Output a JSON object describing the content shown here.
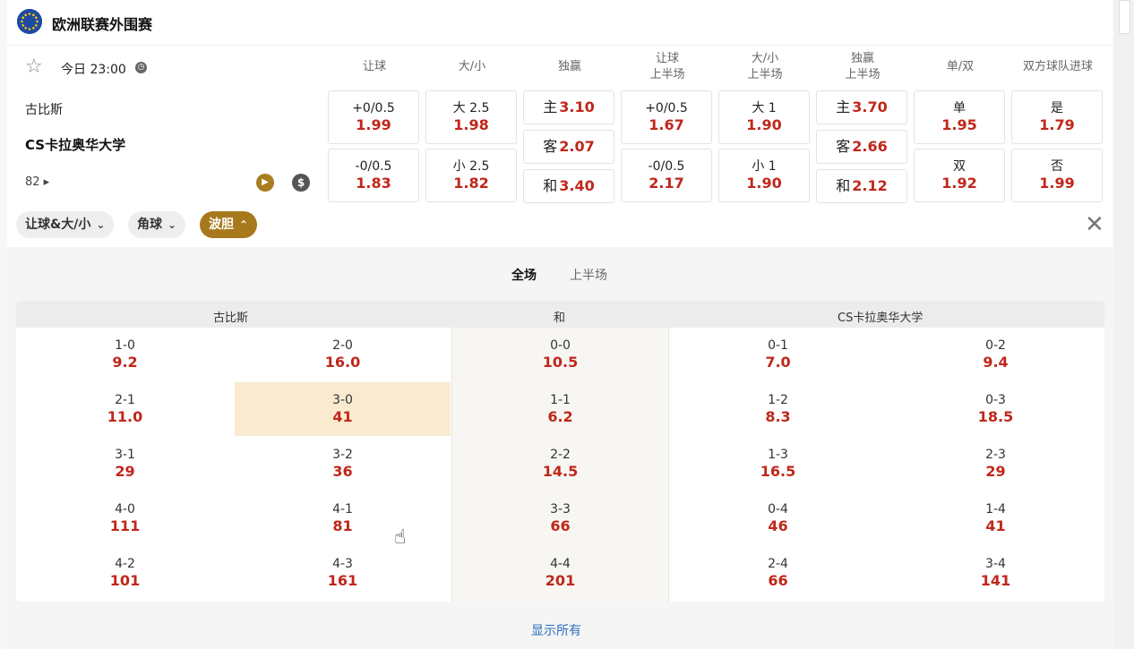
{
  "league": {
    "title": "欧洲联赛外围赛",
    "icon": "eu-flag-icon"
  },
  "match": {
    "time": "今日 23:00",
    "home": "古比斯",
    "away": "CS卡拉奥华大学",
    "more_count": "82"
  },
  "columns": [
    "让球",
    "大/小",
    "独赢",
    "让球\n上半场",
    "大/小\n上半场",
    "独赢\n上半场",
    "单/双",
    "双方球队进球"
  ],
  "odds": {
    "hdp": [
      {
        "label": "+0/0.5",
        "odd": "1.99"
      },
      {
        "label": "-0/0.5",
        "odd": "1.83"
      }
    ],
    "ou": [
      {
        "label": "大 2.5",
        "odd": "1.98"
      },
      {
        "label": "小 2.5",
        "odd": "1.82"
      }
    ],
    "ml": [
      {
        "label": "主",
        "odd": "3.10"
      },
      {
        "label": "客",
        "odd": "2.07"
      },
      {
        "label": "和",
        "odd": "3.40"
      }
    ],
    "hdp_1h": [
      {
        "label": "+0/0.5",
        "odd": "1.67"
      },
      {
        "label": "-0/0.5",
        "odd": "2.17"
      }
    ],
    "ou_1h": [
      {
        "label": "大 1",
        "odd": "1.90"
      },
      {
        "label": "小 1",
        "odd": "1.90"
      }
    ],
    "ml_1h": [
      {
        "label": "主",
        "odd": "3.70"
      },
      {
        "label": "客",
        "odd": "2.66"
      },
      {
        "label": "和",
        "odd": "2.12"
      }
    ],
    "oe": [
      {
        "label": "单",
        "odd": "1.95"
      },
      {
        "label": "双",
        "odd": "1.92"
      }
    ],
    "btts": [
      {
        "label": "是",
        "odd": "1.79"
      },
      {
        "label": "否",
        "odd": "1.99"
      }
    ]
  },
  "filters": [
    {
      "label": "让球&大/小",
      "active": false
    },
    {
      "label": "角球",
      "active": false
    },
    {
      "label": "波胆",
      "active": true
    }
  ],
  "periods": [
    "全场",
    "上半场"
  ],
  "cs_headers": {
    "home": "古比斯",
    "draw": "和",
    "away": "CS卡拉奥华大学"
  },
  "correct_score": {
    "home1": [
      {
        "s": "1-0",
        "o": "9.2"
      },
      {
        "s": "2-1",
        "o": "11.0"
      },
      {
        "s": "3-1",
        "o": "29"
      },
      {
        "s": "4-0",
        "o": "111"
      },
      {
        "s": "4-2",
        "o": "101"
      }
    ],
    "home2": [
      {
        "s": "2-0",
        "o": "16.0"
      },
      {
        "s": "3-0",
        "o": "41"
      },
      {
        "s": "3-2",
        "o": "36"
      },
      {
        "s": "4-1",
        "o": "81"
      },
      {
        "s": "4-3",
        "o": "161"
      }
    ],
    "draw": [
      {
        "s": "0-0",
        "o": "10.5"
      },
      {
        "s": "1-1",
        "o": "6.2"
      },
      {
        "s": "2-2",
        "o": "14.5"
      },
      {
        "s": "3-3",
        "o": "66"
      },
      {
        "s": "4-4",
        "o": "201"
      }
    ],
    "away1": [
      {
        "s": "0-1",
        "o": "7.0"
      },
      {
        "s": "1-2",
        "o": "8.3"
      },
      {
        "s": "1-3",
        "o": "16.5"
      },
      {
        "s": "0-4",
        "o": "46"
      },
      {
        "s": "2-4",
        "o": "66"
      }
    ],
    "away2": [
      {
        "s": "0-2",
        "o": "9.4"
      },
      {
        "s": "0-3",
        "o": "18.5"
      },
      {
        "s": "2-3",
        "o": "29"
      },
      {
        "s": "1-4",
        "o": "41"
      },
      {
        "s": "3-4",
        "o": "141"
      }
    ]
  },
  "show_all": "显示所有",
  "colors": {
    "odd": "#c0271b",
    "accent": "#a8791c",
    "highlight": "#faebd0"
  }
}
